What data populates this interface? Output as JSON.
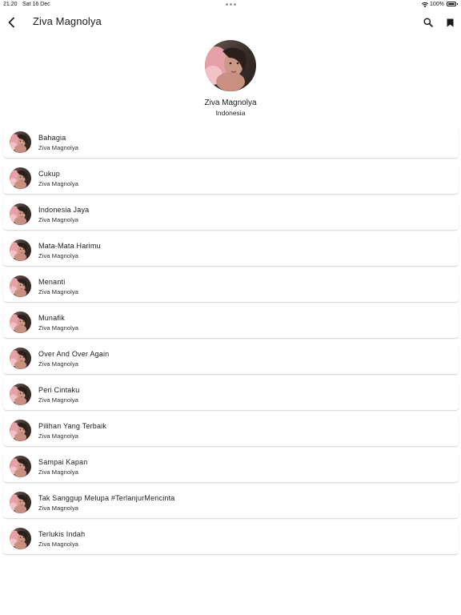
{
  "status_bar": {
    "time": "21.20",
    "date": "Sat 16 Dec",
    "battery": "100%"
  },
  "app_bar": {
    "title": "Ziva Magnolya",
    "icons": [
      "back-arrow-icon",
      "search-icon",
      "bookmark-icon"
    ]
  },
  "artist": {
    "name": "Ziva Magnolya",
    "country": "Indonesia"
  },
  "songs": [
    {
      "title": "Bahagia",
      "artist": "Ziva Magnolya"
    },
    {
      "title": "Cukup",
      "artist": "Ziva Magnolya"
    },
    {
      "title": "Indonesia Jaya",
      "artist": "Ziva Magnolya"
    },
    {
      "title": "Mata-Mata Harimu",
      "artist": "Ziva Magnolya"
    },
    {
      "title": "Menanti",
      "artist": "Ziva Magnolya"
    },
    {
      "title": "Munafik",
      "artist": "Ziva Magnolya"
    },
    {
      "title": "Over And Over Again",
      "artist": "Ziva Magnolya"
    },
    {
      "title": "Peri Cintaku",
      "artist": "Ziva Magnolya"
    },
    {
      "title": "Pilihan Yang Terbaik",
      "artist": "Ziva Magnolya"
    },
    {
      "title": "Sampai Kapan",
      "artist": "Ziva Magnolya"
    },
    {
      "title": "Tak Sanggup Melupa #TerlanjurMencinta",
      "artist": "Ziva Magnolya"
    },
    {
      "title": "Terlukis Indah",
      "artist": "Ziva Magnolya"
    }
  ]
}
